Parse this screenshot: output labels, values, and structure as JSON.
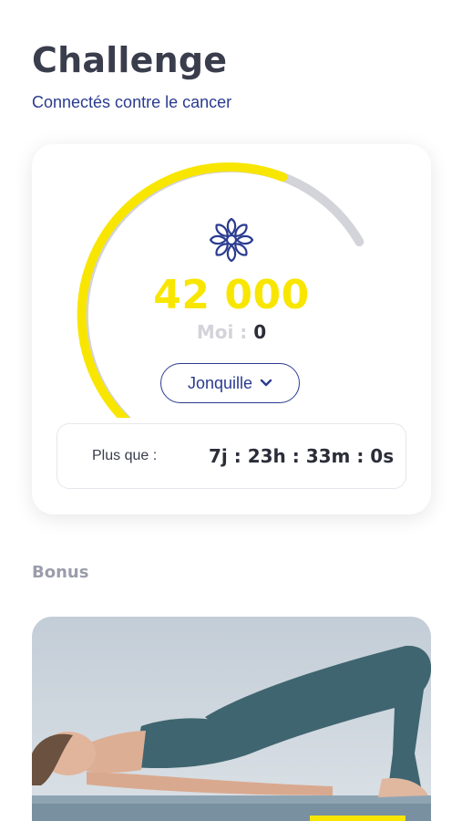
{
  "header": {
    "title": "Challenge",
    "subtitle": "Connectés contre le cancer"
  },
  "challenge": {
    "total_points": "42 000",
    "total_progress": 0.82,
    "my_score_label": "Moi :",
    "my_score": "0",
    "team_select": {
      "selected": "Jonquille"
    },
    "countdown": {
      "label": "Plus que :",
      "value": "7j : 23h : 33m : 0s"
    }
  },
  "bonus": {
    "section_title": "Bonus"
  },
  "colors": {
    "accent_yellow": "#f8e600",
    "brand_blue": "#2a3b8f",
    "gauge_track": "#d3d3da",
    "text_dark": "#3a3d4c"
  },
  "icons": {
    "flower": "flower-icon",
    "dropdown": "chevron-down-icon"
  }
}
